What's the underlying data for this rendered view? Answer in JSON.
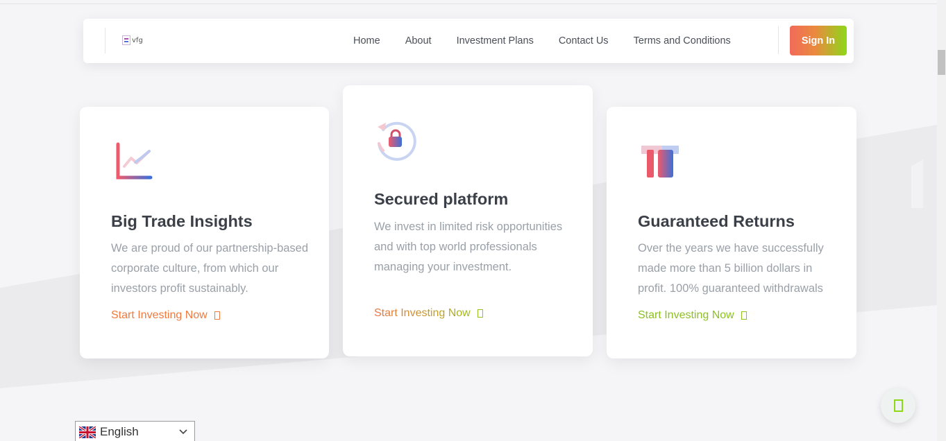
{
  "header": {
    "logo_text": "vfg",
    "nav": [
      "Home",
      "About",
      "Investment Plans",
      "Contact Us",
      "Terms and Conditions"
    ],
    "sign_in_label": "Sign In"
  },
  "features": [
    {
      "title": "Big Trade Insights",
      "description": "We are proud of our partnership-based corporate culture, from which our investors profit sustainably.",
      "link": "Start Investing Now",
      "icon": "chart-growth-icon"
    },
    {
      "title": "Secured platform",
      "description": "We invest in limited risk opportunities and with top world professionals managing your investment.",
      "link": "Start Investing Now",
      "icon": "secure-lock-icon"
    },
    {
      "title": "Guaranteed Returns",
      "description": "Over the years we have successfully made more than 5 billion dollars in profit. 100% guaranteed withdrawals",
      "link": "Start Investing Now",
      "icon": "pillars-icon"
    }
  ],
  "language": {
    "selected": "English",
    "flag": "uk-flag-icon"
  },
  "chat": {
    "icon": "chat-icon"
  },
  "colors": {
    "accent_orange": "#ef7a3f",
    "accent_green": "#8ed81a",
    "accent_blue": "#3f6fd8",
    "accent_red": "#ea5a5a"
  }
}
